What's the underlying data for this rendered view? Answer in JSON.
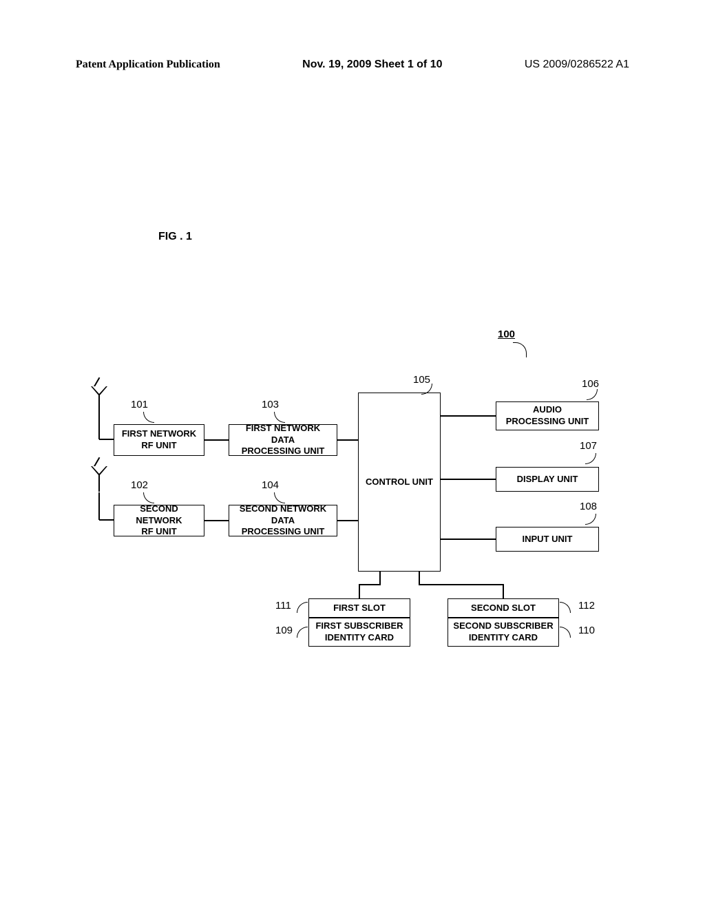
{
  "header": {
    "left": "Patent Application Publication",
    "center": "Nov. 19, 2009 Sheet 1 of 10",
    "right": "US 2009/0286522 A1"
  },
  "figure_label": "FIG . 1",
  "device_num": "100",
  "labels": {
    "l101": "101",
    "l102": "102",
    "l103": "103",
    "l104": "104",
    "l105": "105",
    "l106": "106",
    "l107": "107",
    "l108": "108",
    "l109": "109",
    "l110": "110",
    "l111": "111",
    "l112": "112"
  },
  "boxes": {
    "first_rf": "FIRST NETWORK\nRF UNIT",
    "second_rf": "SECOND NETWORK\nRF UNIT",
    "first_dpu": "FIRST NETWORK DATA\nPROCESSING UNIT",
    "second_dpu": "SECOND NETWORK DATA\nPROCESSING UNIT",
    "control": "CONTROL UNIT",
    "audio": "AUDIO\nPROCESSING UNIT",
    "display": "DISPLAY UNIT",
    "input": "INPUT UNIT",
    "first_slot": "FIRST SLOT",
    "first_sim": "FIRST SUBSCRIBER\nIDENTITY CARD",
    "second_slot": "SECOND SLOT",
    "second_sim": "SECOND SUBSCRIBER\nIDENTITY CARD"
  }
}
